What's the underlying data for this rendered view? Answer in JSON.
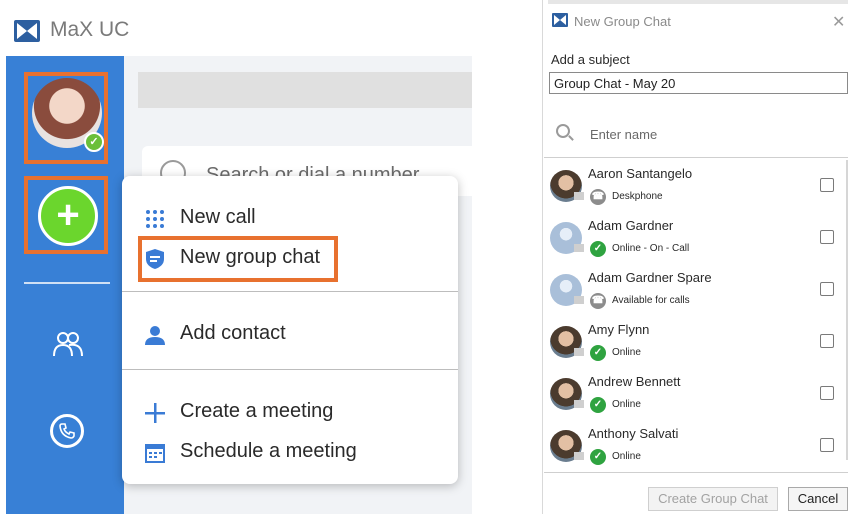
{
  "app": {
    "title": "MaX UC",
    "search_placeholder_peek": "Search or dial a number",
    "sidebar_icons": [
      "contacts-icon",
      "phone-icon"
    ]
  },
  "menu": {
    "items": [
      {
        "label": "New call",
        "icon": "dialpad-icon"
      },
      {
        "label": "New group chat",
        "icon": "group-chat-icon"
      },
      {
        "label": "Add contact",
        "icon": "person-icon"
      },
      {
        "label": "Create a meeting",
        "icon": "plus-icon"
      },
      {
        "label": "Schedule a meeting",
        "icon": "calendar-icon"
      }
    ]
  },
  "dialog": {
    "title": "New Group Chat",
    "subject_label": "Add a subject",
    "subject_value": "Group Chat - May 20",
    "search_placeholder": "Enter name",
    "contacts": [
      {
        "name": "Aaron Santangelo",
        "status": "Deskphone",
        "status_type": "grey",
        "photo": true
      },
      {
        "name": "Adam Gardner",
        "status": "Online - On - Call",
        "status_type": "green",
        "photo": false
      },
      {
        "name": "Adam Gardner Spare",
        "status": "Available for calls",
        "status_type": "grey",
        "photo": false
      },
      {
        "name": "Amy Flynn",
        "status": "Online",
        "status_type": "green",
        "photo": true
      },
      {
        "name": "Andrew Bennett",
        "status": "Online",
        "status_type": "green",
        "photo": true
      },
      {
        "name": "Anthony Salvati",
        "status": "Online",
        "status_type": "green",
        "photo": true
      }
    ],
    "create_label": "Create Group Chat",
    "cancel_label": "Cancel"
  },
  "colors": {
    "sidebar": "#3880d6",
    "highlight": "#e8712f",
    "add_button": "#6bd62d",
    "online": "#2fa340",
    "menu_icon": "#3a7bd5"
  }
}
